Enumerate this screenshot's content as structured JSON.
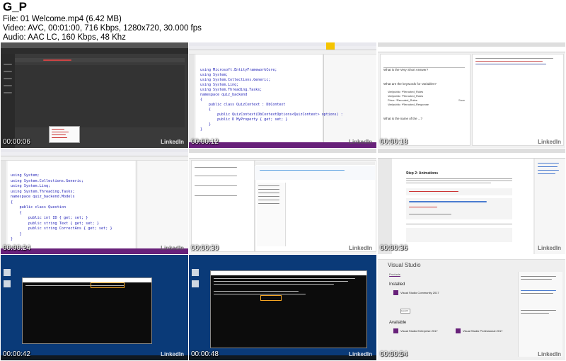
{
  "header": {
    "title": "G_P",
    "file": "File: 01     Welcome.mp4 (6.42 MB)",
    "video": "Video: AVC, 00:01:00, 716 Kbps, 1280x720, 30.000 fps",
    "audio": "Audio: AAC LC, 160 Kbps, 48 Khz"
  },
  "tiles": [
    {
      "timestamp": "00:00:06"
    },
    {
      "timestamp": "00:00:12"
    },
    {
      "timestamp": "00:00:18"
    },
    {
      "timestamp": "00:00:24"
    },
    {
      "timestamp": "00:00:30"
    },
    {
      "timestamp": "00:00:36"
    },
    {
      "timestamp": "00:00:42"
    },
    {
      "timestamp": "00:00:48"
    },
    {
      "timestamp": "00:00:54"
    }
  ],
  "watermark": "LinkedIn",
  "code_tile2": [
    "using Microsoft.EntityFrameworkCore;",
    "using System;",
    "using System.Collections.Generic;",
    "using System.Linq;",
    "using System.Threading.Tasks;",
    "",
    "namespace quiz_backend",
    "{",
    "    public class QuizContext : DbContext",
    "    {",
    "        public QuizContext(DbContextOptions<QuizContext> options) :",
    "",
    "        public D MyProperty { get; set; }",
    "    }",
    "}"
  ],
  "code_tile4": [
    "using System;",
    "using System.Collections.Generic;",
    "using System.Linq;",
    "using System.Threading.Tasks;",
    "",
    "namespace quiz_backend.Models",
    "{",
    "    public class Question",
    "    {",
    "        public int ID { get; set; }",
    "        public string Text { get; set; }",
    "        public string CorrectAns { get; set; }",
    "    }",
    "}"
  ],
  "tile3_form": {
    "q1": "What is the Very Short Answer?",
    "q2": "What are the keywords for Variables?",
    "options": [
      "Var/public: *Rerouted_Rules",
      "Var/public: *Rerouted_Rules",
      "Price: *Rerouted_Rules",
      "Var/public: *Rerouted_Response"
    ],
    "q3": "What is the name of the ...?",
    "submit": "Save"
  },
  "tile6_doc": {
    "heading": "Step 2: Animations"
  },
  "tile9_installer": {
    "title": "Visual Studio",
    "tab": "Products",
    "installed": "Installed",
    "product1": "Visual Studio Community 2017",
    "available": "Available",
    "product2": "Visual Studio Enterprise 2017",
    "product3": "Visual Studio Professional 2017",
    "launch": "Launch"
  }
}
